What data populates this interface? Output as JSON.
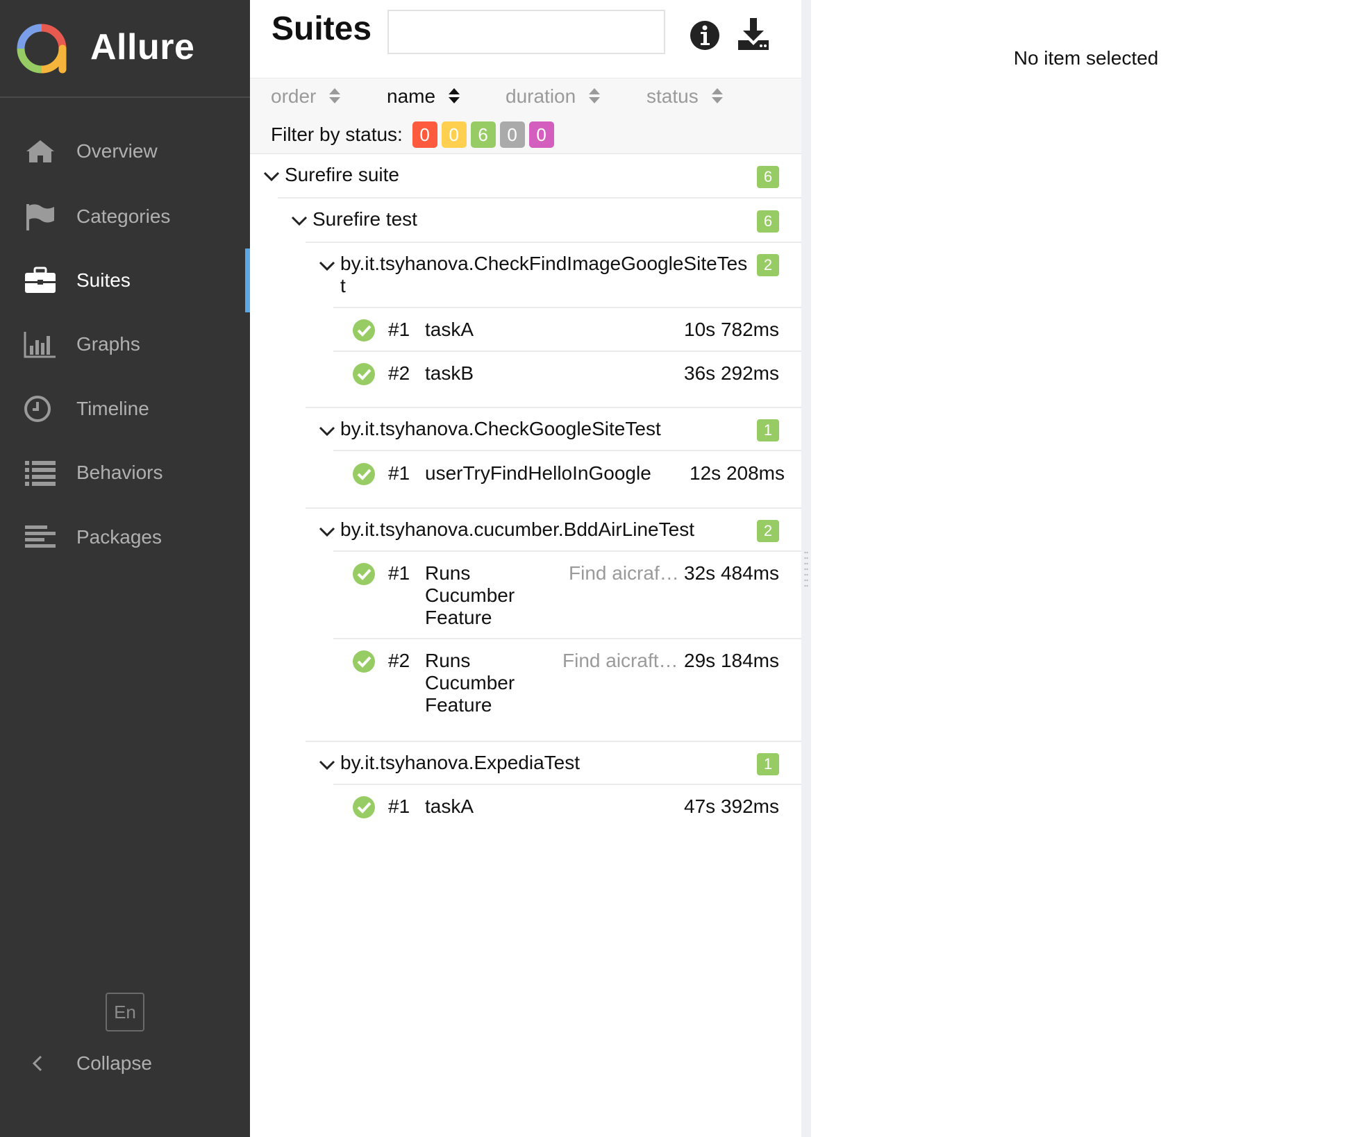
{
  "sidebar": {
    "brand": "Allure",
    "items": [
      {
        "label": "Overview",
        "icon": "home-icon"
      },
      {
        "label": "Categories",
        "icon": "flag-icon"
      },
      {
        "label": "Suites",
        "icon": "briefcase-icon",
        "active": true
      },
      {
        "label": "Graphs",
        "icon": "bar-chart-icon"
      },
      {
        "label": "Timeline",
        "icon": "clock-icon"
      },
      {
        "label": "Behaviors",
        "icon": "list-icon"
      },
      {
        "label": "Packages",
        "icon": "align-left-icon"
      }
    ],
    "language": "En",
    "collapse_label": "Collapse"
  },
  "header": {
    "title": "Suites",
    "search": {
      "value": "",
      "placeholder": ""
    }
  },
  "toolbar": {
    "sort": [
      {
        "label": "order",
        "active": false
      },
      {
        "label": "name",
        "active": true
      },
      {
        "label": "duration",
        "active": false
      },
      {
        "label": "status",
        "active": false
      }
    ],
    "filter_label": "Filter by status:",
    "status_counts": [
      {
        "status": "failed",
        "count": "0",
        "color": "#fd5a3e"
      },
      {
        "status": "broken",
        "count": "0",
        "color": "#ffd050"
      },
      {
        "status": "passed",
        "count": "6",
        "color": "#97cc64"
      },
      {
        "status": "skipped",
        "count": "0",
        "color": "#aaaaaa"
      },
      {
        "status": "unknown",
        "count": "0",
        "color": "#d35ebe"
      }
    ]
  },
  "tree": {
    "suite": {
      "name": "Surefire suite",
      "count": "6"
    },
    "test": {
      "name": "Surefire test",
      "count": "6"
    },
    "classes": [
      {
        "name_line1": "by.it.tsyhanova.CheckFindImageGoogleSiteTes",
        "name_line2": "t",
        "count": "2",
        "cases": [
          {
            "num": "#1",
            "name": "taskA",
            "duration": "10s 782ms"
          },
          {
            "num": "#2",
            "name": "taskB",
            "duration": "36s 292ms"
          }
        ]
      },
      {
        "name": "by.it.tsyhanova.CheckGoogleSiteTest",
        "count": "1",
        "cases": [
          {
            "num": "#1",
            "name": "userTryFindHelloInGoogle",
            "duration": "12s 208ms"
          }
        ]
      },
      {
        "name": "by.it.tsyhanova.cucumber.BddAirLineTest",
        "count": "2",
        "cases": [
          {
            "num": "#1",
            "name_lines": [
              "Runs",
              "Cucumber",
              "Feature"
            ],
            "description": "Find aicraf…",
            "duration": "32s 484ms"
          },
          {
            "num": "#2",
            "name_lines": [
              "Runs",
              "Cucumber",
              "Feature"
            ],
            "description": "Find aicraft…",
            "duration": "29s 184ms"
          }
        ]
      },
      {
        "name": "by.it.tsyhanova.ExpediaTest",
        "count": "1",
        "cases": [
          {
            "num": "#1",
            "name": "taskA",
            "duration": "47s 392ms"
          }
        ]
      }
    ]
  },
  "details": {
    "empty_message": "No item selected"
  },
  "colors": {
    "sidebar_bg": "#343434",
    "accent": "#5aa9e6",
    "passed": "#97cc64"
  }
}
